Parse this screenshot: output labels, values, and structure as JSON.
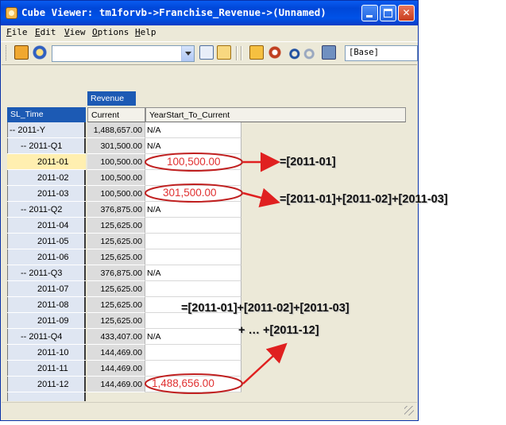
{
  "window": {
    "title": "Cube Viewer: tm1forvb->Franchise_Revenue->(Unnamed)",
    "controls": [
      "minimize",
      "maximize",
      "close"
    ]
  },
  "menu": [
    {
      "label": "File",
      "accel": "F",
      "rest": "ile"
    },
    {
      "label": "Edit",
      "accel": "E",
      "rest": "dit"
    },
    {
      "label": "View",
      "accel": "V",
      "rest": "iew"
    },
    {
      "label": "Options",
      "accel": "O",
      "rest": "ptions"
    },
    {
      "label": "Help",
      "accel": "H",
      "rest": "elp"
    }
  ],
  "toolbar": {
    "view_combo_value": "",
    "base_value": "[Base]",
    "icons": [
      "save-icon",
      "recalculate-icon",
      "calculator-icon",
      "calculator-active-icon",
      "forward-icon",
      "sandbox-icon",
      "undo-icon",
      "redo-icon",
      "export-icon"
    ]
  },
  "grid": {
    "title_dimension": "Revenue",
    "row_dimension": "SL_Time",
    "columns": [
      "Current",
      "YearStart_To_Current"
    ],
    "rows": [
      {
        "label": "-- 2011-Y",
        "level": 0,
        "current": "1,488,657.00",
        "ystc": "N/A"
      },
      {
        "label": "-- 2011-Q1",
        "level": 1,
        "current": "301,500.00",
        "ystc": "N/A"
      },
      {
        "label": "2011-01",
        "level": 2,
        "current": "100,500.00",
        "ystc": "",
        "selected": true
      },
      {
        "label": "2011-02",
        "level": 2,
        "current": "100,500.00",
        "ystc": ""
      },
      {
        "label": "2011-03",
        "level": 2,
        "current": "100,500.00",
        "ystc": ""
      },
      {
        "label": "-- 2011-Q2",
        "level": 1,
        "current": "376,875.00",
        "ystc": "N/A"
      },
      {
        "label": "2011-04",
        "level": 2,
        "current": "125,625.00",
        "ystc": ""
      },
      {
        "label": "2011-05",
        "level": 2,
        "current": "125,625.00",
        "ystc": ""
      },
      {
        "label": "2011-06",
        "level": 2,
        "current": "125,625.00",
        "ystc": ""
      },
      {
        "label": "-- 2011-Q3",
        "level": 1,
        "current": "376,875.00",
        "ystc": "N/A"
      },
      {
        "label": "2011-07",
        "level": 2,
        "current": "125,625.00",
        "ystc": ""
      },
      {
        "label": "2011-08",
        "level": 2,
        "current": "125,625.00",
        "ystc": ""
      },
      {
        "label": "2011-09",
        "level": 2,
        "current": "125,625.00",
        "ystc": ""
      },
      {
        "label": "-- 2011-Q4",
        "level": 1,
        "current": "433,407.00",
        "ystc": "N/A"
      },
      {
        "label": "2011-10",
        "level": 2,
        "current": "144,469.00",
        "ystc": ""
      },
      {
        "label": "2011-11",
        "level": 2,
        "current": "144,469.00",
        "ystc": ""
      },
      {
        "label": "2011-12",
        "level": 2,
        "current": "144,469.00",
        "ystc": ""
      }
    ]
  },
  "annotations": {
    "value_jan": "100,500.00",
    "value_mar": "301,500.00",
    "value_dec": "1,488,656.00",
    "formula_jan": "=[2011-01]",
    "formula_mar": "=[2011-01]+[2011-02]+[2011-03]",
    "formula_dec_line1": "=[2011-01]+[2011-02]+[2011-03]",
    "formula_dec_line2": "+ … +[2011-12]",
    "accent_color": "#e02020"
  }
}
